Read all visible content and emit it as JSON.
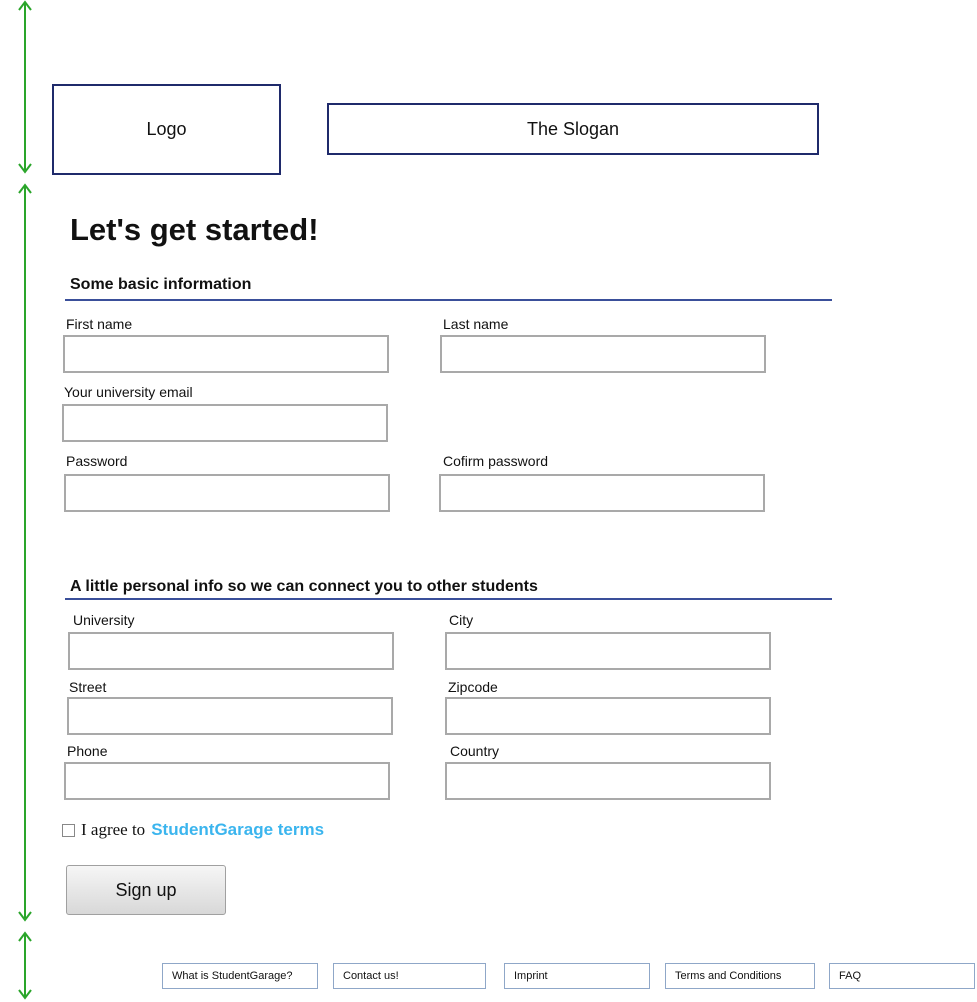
{
  "header": {
    "logo": "Logo",
    "slogan": "The Slogan"
  },
  "page_title": "Let's get started!",
  "basic": {
    "heading": "Some basic information",
    "first_name_label": "First name",
    "last_name_label": "Last name",
    "email_label": "Your university email",
    "password_label": "Password",
    "confirm_password_label": "Cofirm password",
    "first_name_value": "",
    "last_name_value": "",
    "email_value": "",
    "password_value": "",
    "confirm_password_value": ""
  },
  "personal": {
    "heading": "A little personal info so we can connect you to other students",
    "university_label": "University",
    "city_label": "City",
    "street_label": "Street",
    "zipcode_label": "Zipcode",
    "phone_label": "Phone",
    "country_label": "Country",
    "university_value": "",
    "city_value": "",
    "street_value": "",
    "zipcode_value": "",
    "phone_value": "",
    "country_value": ""
  },
  "agree": {
    "text": "I agree to",
    "link": "StudentGarage terms",
    "checked": false
  },
  "signup_label": "Sign up",
  "footer": {
    "items": [
      "What is StudentGarage?",
      "Contact us!",
      "Imprint",
      "Terms and Conditions",
      "FAQ"
    ]
  },
  "colors": {
    "guide": "#2aa52a",
    "accent_link": "#3bb5ee",
    "rule": "#3a4f9a",
    "box_border": "#1f2a6b"
  }
}
